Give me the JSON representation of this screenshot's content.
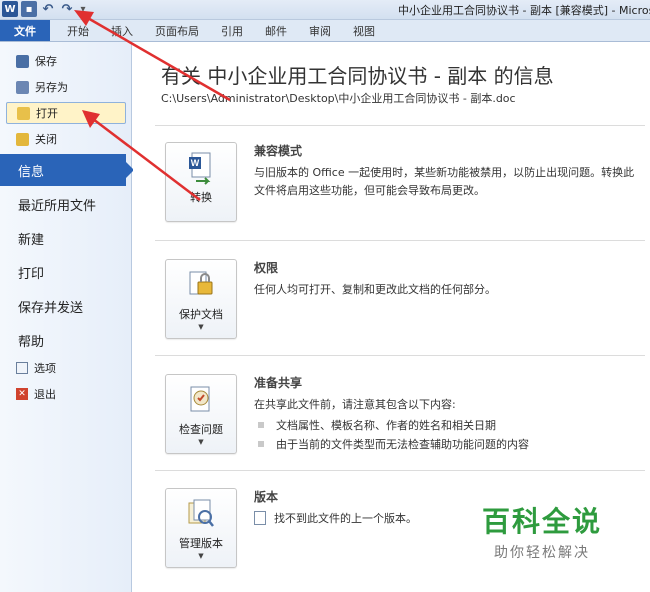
{
  "titlebar": {
    "window_title": "中小企业用工合同协议书 - 副本 [兼容模式] - Micros",
    "word_icon": "word-icon",
    "save_icon": "save-icon",
    "undo_icon": "undo-icon",
    "redo_icon": "redo-icon"
  },
  "ribbon": {
    "tabs": [
      {
        "label": "文件"
      },
      {
        "label": "开始"
      },
      {
        "label": "插入"
      },
      {
        "label": "页面布局"
      },
      {
        "label": "引用"
      },
      {
        "label": "邮件"
      },
      {
        "label": "审阅"
      },
      {
        "label": "视图"
      }
    ]
  },
  "sidebar": {
    "small_top": [
      {
        "label": "保存",
        "icon": "save-icon"
      },
      {
        "label": "另存为",
        "icon": "save-as-icon"
      },
      {
        "label": "打开",
        "icon": "open-folder-icon"
      },
      {
        "label": "关闭",
        "icon": "close-folder-icon"
      }
    ],
    "big": [
      {
        "label": "信息"
      },
      {
        "label": "最近所用文件"
      },
      {
        "label": "新建"
      },
      {
        "label": "打印"
      },
      {
        "label": "保存并发送"
      },
      {
        "label": "帮助"
      }
    ],
    "small_bottom": [
      {
        "label": "选项",
        "icon": "options-icon"
      },
      {
        "label": "退出",
        "icon": "exit-icon"
      }
    ]
  },
  "main": {
    "title": "有关 中小企业用工合同协议书 - 副本 的信息",
    "path": "C:\\Users\\Administrator\\Desktop\\中小企业用工合同协议书 - 副本.doc",
    "sections": [
      {
        "button_label": "转换",
        "icon": "convert-document-icon",
        "heading": "兼容模式",
        "desc": "与旧版本的 Office 一起使用时，某些新功能被禁用，以防止出现问题。转换此文件将启用这些功能，但可能会导致布局更改。"
      },
      {
        "button_label": "保护文档",
        "icon": "protect-document-icon",
        "heading": "权限",
        "desc": "任何人均可打开、复制和更改此文档的任何部分。"
      },
      {
        "button_label": "检查问题",
        "icon": "check-issues-icon",
        "heading": "准备共享",
        "desc": "在共享此文件前，请注意其包含以下内容:",
        "bullets": [
          "文档属性、模板名称、作者的姓名和相关日期",
          "由于当前的文件类型而无法检查辅助功能问题的内容"
        ]
      },
      {
        "button_label": "管理版本",
        "icon": "manage-versions-icon",
        "heading": "版本",
        "desc": "找不到此文件的上一个版本。"
      }
    ]
  },
  "watermark": {
    "title": "百科全说",
    "subtitle": "助你轻松解决"
  },
  "colors": {
    "accent": "#2a64b8",
    "annotation_arrow": "#e03030",
    "watermark_green": "#2e9b3e"
  }
}
